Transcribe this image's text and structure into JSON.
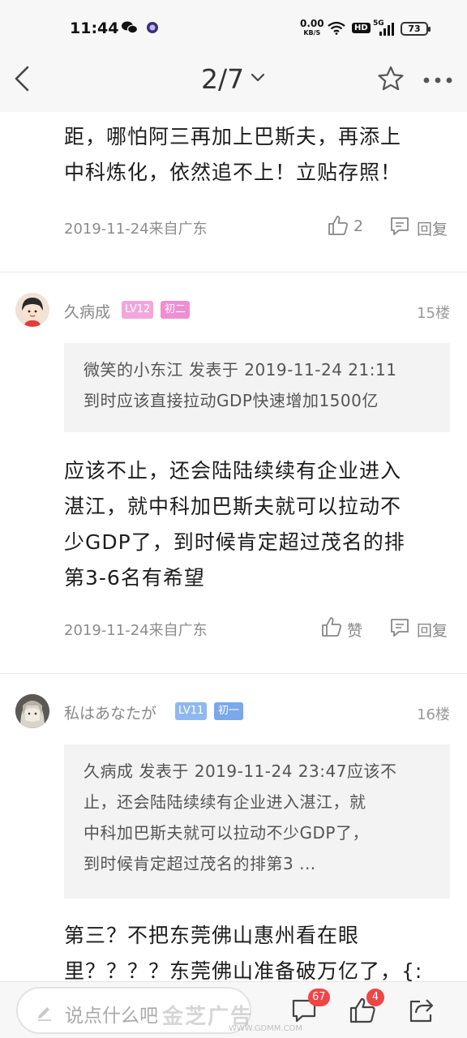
{
  "status_bar": {
    "time": "11:44",
    "net_speed_value": "0.00",
    "net_speed_unit": "KB/S",
    "hd_label": "HD",
    "network_label": "5G",
    "battery": "73"
  },
  "nav": {
    "page_indicator": "2/7"
  },
  "posts": [
    {
      "body": "远超湛江……距，哪怕阿三再加上巴斯夫，再添上中科炼化，依然追不上！立贴存照！",
      "body_lines": [
        "距，哪怕阿三再加上巴斯夫，再添上",
        "中科炼化，依然追不上！立贴存照！"
      ],
      "date": "2019-11-24来自广东",
      "like_label": "2",
      "reply_label": "回复"
    },
    {
      "username": "久病成",
      "level": "LV12",
      "rank": "初二",
      "floor": "15楼",
      "quote_lines": [
        "微笑的小东江 发表于 2019-11-24 21:11",
        "到时应该直接拉动GDP快速增加1500亿"
      ],
      "body_lines": [
        "应该不止，还会陆陆续续有企业进入",
        "湛江，就中科加巴斯夫就可以拉动不",
        "少GDP了，到时候肯定超过茂名的排",
        "第3-6名有希望"
      ],
      "date": "2019-11-24来自广东",
      "like_label": "赞",
      "reply_label": "回复"
    },
    {
      "username": "私はあなたが",
      "level": "LV11",
      "rank": "初一",
      "floor": "16楼",
      "quote_lines": [
        "久病成 发表于 2019-11-24 23:47应该不",
        "止，还会陆陆续续有企业进入湛江，就",
        "中科加巴斯夫就可以拉动不少GDP了，",
        "到时候肯定超过茂名的排第3 ..."
      ],
      "body_lines": [
        "第三？不把东莞佛山惠州看在眼",
        "里？？？？东莞佛山准备破万亿了，{:"
      ]
    }
  ],
  "bottom_bar": {
    "comment_placeholder": "说点什么吧",
    "comment_count": "67",
    "like_count": "4",
    "watermark_text": "金芝广告",
    "watermark_url": "WWW.GDMM.COM"
  },
  "colors": {
    "lv12_badge": "#f2a6dc",
    "rank_pink": "#ee8fd2",
    "lv11_badge": "#8fb8ee",
    "rank_blue": "#7aa8e8",
    "badge_red": "#f04545"
  }
}
